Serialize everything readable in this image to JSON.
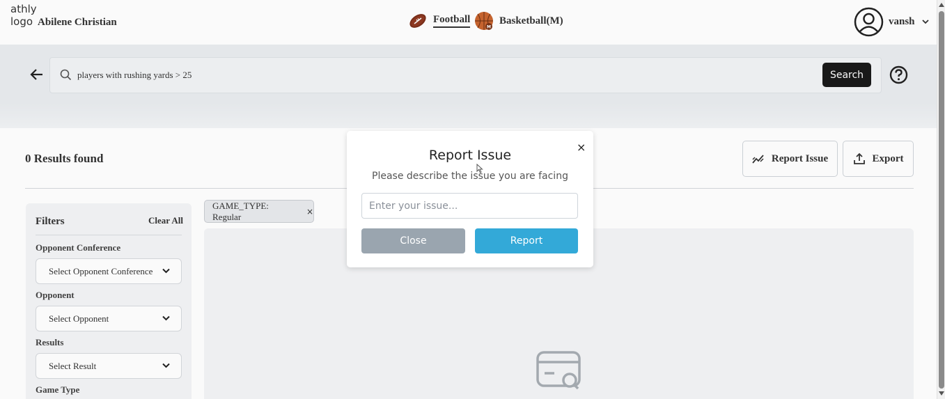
{
  "header": {
    "logo_alt": "athly logo",
    "org_name": "Abilene Christian",
    "sports": [
      {
        "label": "Football",
        "active": true,
        "icon": "football-icon"
      },
      {
        "label": "Basketball(M)",
        "active": false,
        "icon": "basketball-icon"
      }
    ],
    "user": {
      "name": "vansh",
      "icon": "user-avatar-icon"
    }
  },
  "search": {
    "query": "players with rushing yards > 25",
    "button_label": "Search"
  },
  "results": {
    "count_text": "0 Results found",
    "report_issue_label": "Report Issue",
    "export_label": "Export"
  },
  "filters": {
    "title": "Filters",
    "clear_all": "Clear All",
    "groups": [
      {
        "label": "Opponent Conference",
        "placeholder": "Select Opponent Conference"
      },
      {
        "label": "Opponent",
        "placeholder": "Select Opponent"
      },
      {
        "label": "Results",
        "placeholder": "Select Result"
      },
      {
        "label": "Game Type"
      }
    ]
  },
  "active_filters": [
    {
      "label": "GAME_TYPE: Regular",
      "remove": "×"
    }
  ],
  "modal": {
    "close_x": "×",
    "title": "Report Issue",
    "subtitle": "Please describe the issue you are facing",
    "input_placeholder": "Enter your issue...",
    "close_label": "Close",
    "report_label": "Report"
  },
  "colors": {
    "primary": "#33a9d8",
    "close_button": "#9aa5af",
    "search_button": "#1a1a1a"
  }
}
